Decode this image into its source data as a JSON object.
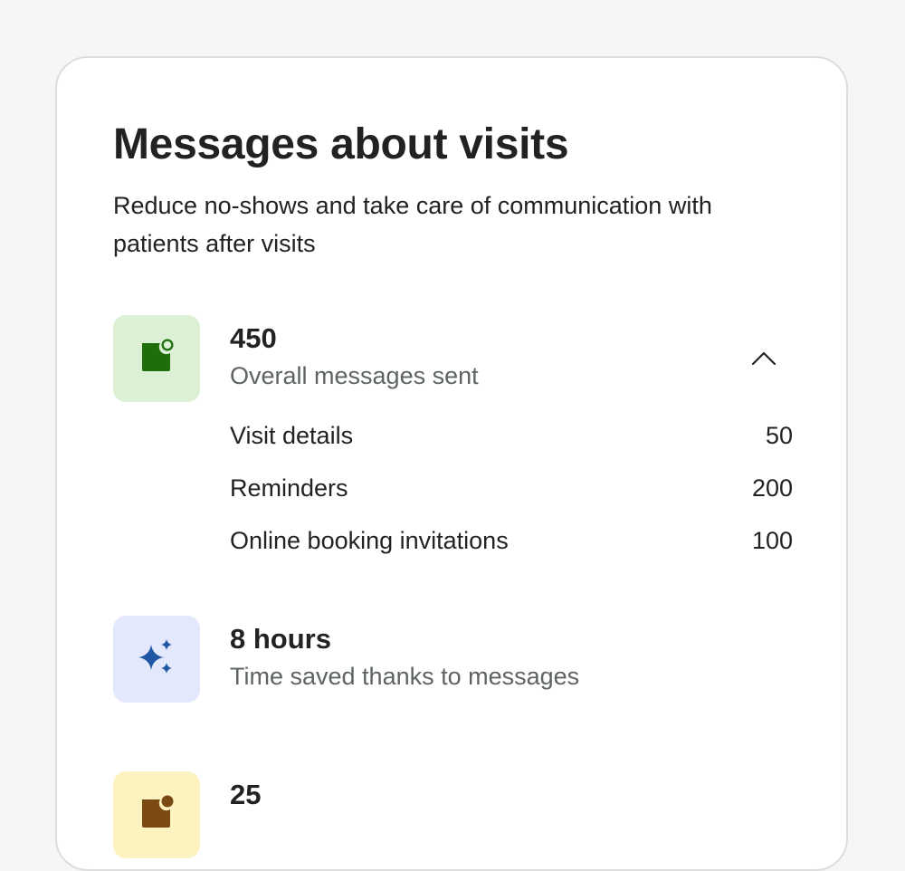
{
  "card": {
    "title": "Messages about visits",
    "subtitle": "Reduce no-shows and take care of communication with patients after visits"
  },
  "stats": [
    {
      "value": "450",
      "label": "Overall messages sent",
      "icon": "message-icon",
      "tile_color": "#dbf0d4",
      "icon_color": "#1e6e0c",
      "expanded": true,
      "breakdown": [
        {
          "label": "Visit details",
          "value": "50"
        },
        {
          "label": "Reminders",
          "value": "200"
        },
        {
          "label": "Online booking invitations",
          "value": "100"
        }
      ]
    },
    {
      "value": "8 hours",
      "label": "Time saved thanks to messages",
      "icon": "sparkles-icon",
      "tile_color": "#e4e8fc",
      "icon_color": "#1f57a4"
    },
    {
      "value": "25",
      "label": "",
      "icon": "message-icon",
      "tile_color": "#fdf3c0",
      "icon_color": "#7a4a12"
    }
  ]
}
